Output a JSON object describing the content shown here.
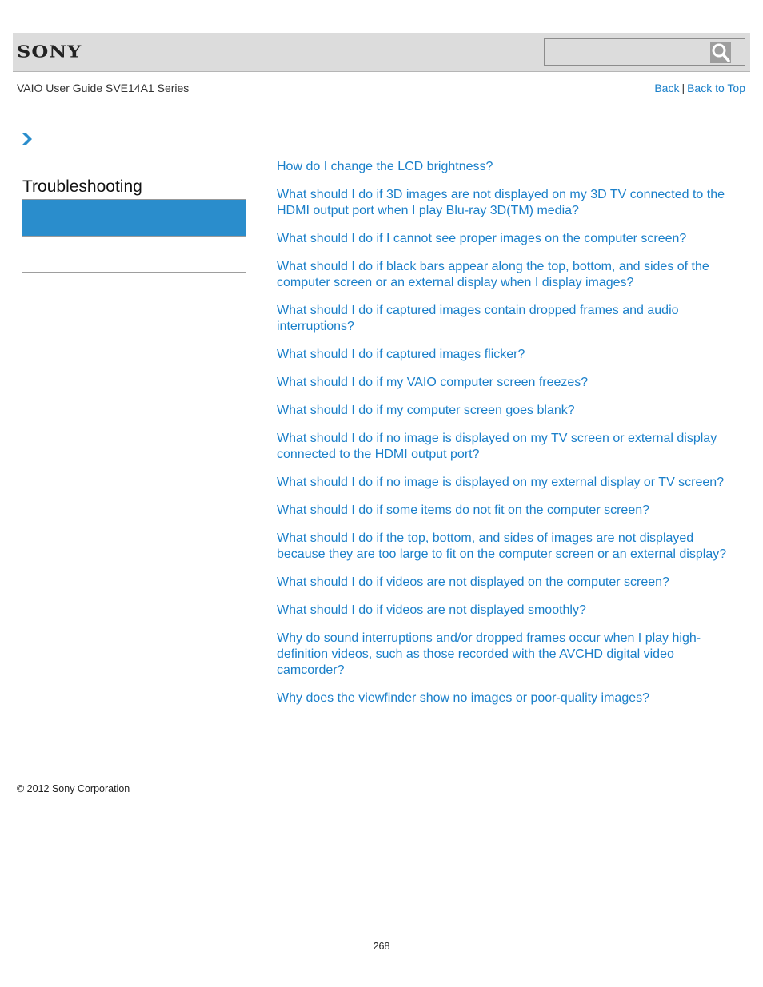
{
  "header": {
    "logo": "SONY",
    "search": {
      "placeholder": "",
      "value": ""
    },
    "search_icon": "magnifier-icon"
  },
  "subheader": {
    "guide_title": "VAIO User Guide SVE14A1 Series",
    "back_label": "Back",
    "separator": "|",
    "back_to_top_label": "Back to Top"
  },
  "breadcrumb": {
    "icon": "chevron-right-icon"
  },
  "sidebar": {
    "section_title": "Troubleshooting",
    "items": [
      {
        "label": "",
        "active": true
      },
      {
        "label": "",
        "active": false
      },
      {
        "label": "",
        "active": false
      },
      {
        "label": "",
        "active": false
      },
      {
        "label": "",
        "active": false
      },
      {
        "label": "",
        "active": false
      }
    ]
  },
  "faq": [
    "How do I change the LCD brightness?",
    "What should I do if 3D images are not displayed on my 3D TV connected to the HDMI output port when I play Blu-ray 3D(TM) media?",
    "What should I do if I cannot see proper images on the computer screen?",
    "What should I do if black bars appear along the top, bottom, and sides of the computer screen or an external display when I display images?",
    "What should I do if captured images contain dropped frames and audio interruptions?",
    "What should I do if captured images flicker?",
    "What should I do if my VAIO computer screen freezes?",
    "What should I do if my computer screen goes blank?",
    "What should I do if no image is displayed on my TV screen or external display connected to the HDMI output port?",
    "What should I do if no image is displayed on my external display or TV screen?",
    "What should I do if some items do not fit on the computer screen?",
    "What should I do if the top, bottom, and sides of images are not displayed because they are too large to fit on the computer screen or an external display?",
    "What should I do if videos are not displayed on the computer screen?",
    "What should I do if videos are not displayed smoothly?",
    "Why do sound interruptions and/or dropped frames occur when I play high-definition videos, such as those recorded with the AVCHD digital video camcorder?",
    "Why does the viewfinder show no images or poor-quality images?"
  ],
  "footer": {
    "copyright": "© 2012 Sony Corporation",
    "page_number": "268"
  },
  "colors": {
    "link": "#1a7fc9",
    "active_nav": "#2a8dcc",
    "header_bg": "#dcdcdc"
  }
}
